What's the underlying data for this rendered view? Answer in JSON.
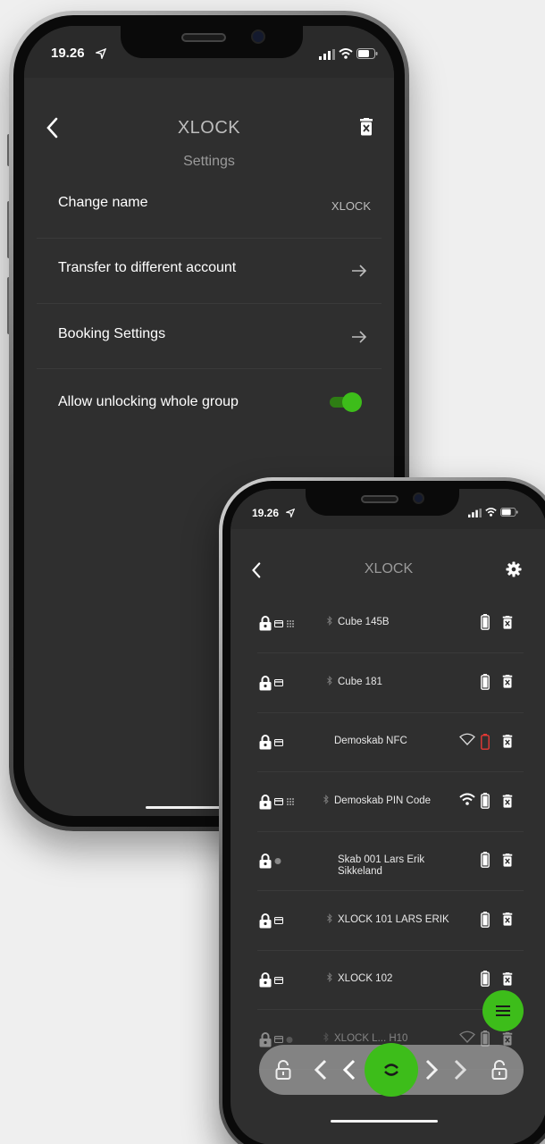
{
  "phone1": {
    "status": {
      "time": "19.26"
    },
    "header": {
      "title": "XLOCK",
      "subtitle": "Settings"
    },
    "rows": [
      {
        "label": "Change name",
        "value": "XLOCK"
      },
      {
        "label": "Transfer to different account"
      },
      {
        "label": "Booking Settings"
      },
      {
        "label": "Allow unlocking whole group",
        "toggle": true
      }
    ]
  },
  "phone2": {
    "status": {
      "time": "19.26"
    },
    "header": {
      "title": "XLOCK"
    },
    "locks": [
      {
        "name": "Cube 145B"
      },
      {
        "name": "Cube 181"
      },
      {
        "name": "Demoskab NFC"
      },
      {
        "name": "Demoskab PIN Code"
      },
      {
        "name": "Skab 001 Lars Erik Sikkeland"
      },
      {
        "name": "XLOCK 101 LARS ERIK"
      },
      {
        "name": "XLOCK 102"
      },
      {
        "name": "XLOCK L... H10"
      }
    ]
  },
  "colors": {
    "accent": "#3dbd1a",
    "screen_bg": "#2f2f2f",
    "low_battery": "#e53935"
  },
  "icons": [
    "back-arrow-icon",
    "trash-icon",
    "forward-arrow-icon",
    "gear-icon",
    "padlock-icon",
    "card-icon",
    "keypad-icon",
    "bluetooth-icon",
    "battery-icon",
    "wifi-icon",
    "menu-icon",
    "sync-icon",
    "chevron-left-icon",
    "chevron-right-icon",
    "unlock-icon"
  ]
}
